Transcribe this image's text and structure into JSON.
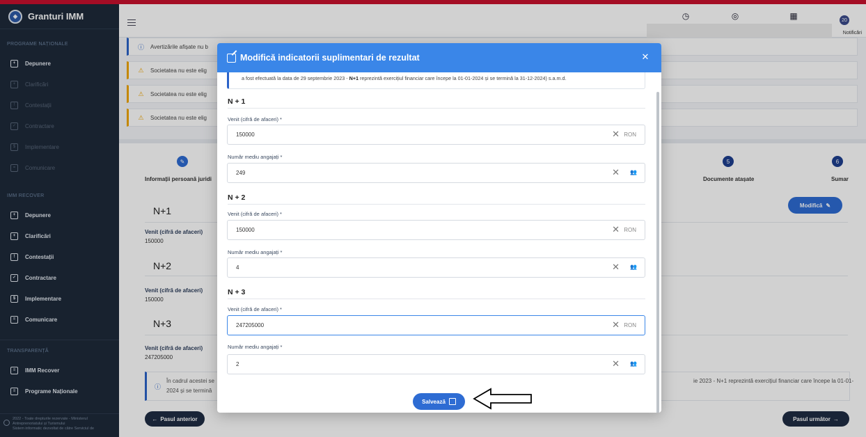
{
  "app": {
    "brand": "Granturi IMM"
  },
  "sidebar": {
    "sections": [
      {
        "title": "PROGRAME NAȚIONALE",
        "items": [
          {
            "label": "Depunere",
            "icon": "plus-box-icon",
            "active": true
          },
          {
            "label": "Clarificări",
            "icon": "plus-box-icon",
            "active": false
          },
          {
            "label": "Contestații",
            "icon": "alert-box-icon",
            "active": false
          },
          {
            "label": "Contractare",
            "icon": "check-box-icon",
            "active": false
          },
          {
            "label": "Implementare",
            "icon": "dollar-box-icon",
            "active": false
          },
          {
            "label": "Comunicare",
            "icon": "chat-box-icon",
            "active": false
          }
        ]
      },
      {
        "title": "IMM RECOVER",
        "items": [
          {
            "label": "Depunere",
            "icon": "plus-box-icon",
            "active": true
          },
          {
            "label": "Clarificări",
            "icon": "plus-box-icon",
            "active": true
          },
          {
            "label": "Contestații",
            "icon": "alert-box-icon",
            "active": true
          },
          {
            "label": "Contractare",
            "icon": "check-box-icon",
            "active": true
          },
          {
            "label": "Implementare",
            "icon": "dollar-box-icon",
            "active": true
          },
          {
            "label": "Comunicare",
            "icon": "chat-box-icon",
            "active": true
          }
        ]
      },
      {
        "title": "TRANSPARENȚĂ",
        "items": [
          {
            "label": "IMM Recover",
            "icon": "list-box-icon",
            "active": true
          },
          {
            "label": "Programe Naționale",
            "icon": "list-box-icon",
            "active": true
          }
        ]
      }
    ],
    "footer": {
      "line1": "2022 - Toate drepturile rezervate - Ministerul",
      "line2": "Antreprenoriatului și Turismului",
      "line3": "Sistem informatic dezvoltat de către Serviciul de"
    }
  },
  "topbar": {
    "notif_label": "Notificări",
    "notif_count": "20"
  },
  "alerts": [
    {
      "type": "info",
      "text": "Avertizările afișate nu b"
    },
    {
      "type": "warn",
      "text": "Societatea nu este elig"
    },
    {
      "type": "warn",
      "text": "Societatea nu este elig"
    },
    {
      "type": "warn",
      "text": "Societatea nu este elig"
    }
  ],
  "steps": {
    "first_label": "Informații persoană juridi",
    "step5_num": "5",
    "step5_label": "Documente atașate",
    "step6_num": "6",
    "step6_label": "Sumar"
  },
  "bg_fields": {
    "n1": "N+1",
    "n2": "N+2",
    "n3": "N+3",
    "venit_label": "Venit (cifră de afaceri)",
    "n1_val": "150000",
    "n2_val": "150000",
    "n3_val": "247205000",
    "modify_label": "Modifică",
    "info_t1": "În cadrul acestei se",
    "info_t2": "2024 și se termină",
    "info_t3": "ie 2023 - N+1 reprezintă exercițiul financiar care începe la 01-01-"
  },
  "nav": {
    "prev": "Pasul anterior",
    "next": "Pasul următor"
  },
  "modal": {
    "title": "Modifică indicatorii suplimentari de rezultat",
    "note_pre": "a fost efectuată la data de 29 septembrie 2023 - ",
    "note_bold": "N+1",
    "note_post": " reprezintă exercițiul financiar care începe la 01-01-2024 și se termină la 31-12-2024) s.a.m.d.",
    "sections": [
      {
        "title": "N + 1",
        "venit_label": "Venit (cifră de afaceri) *",
        "venit": "150000",
        "unit": "RON",
        "angajati_label": "Număr mediu angajați *",
        "angajati": "249"
      },
      {
        "title": "N + 2",
        "venit_label": "Venit (cifră de afaceri) *",
        "venit": "150000",
        "unit": "RON",
        "angajati_label": "Număr mediu angajați *",
        "angajati": "4"
      },
      {
        "title": "N + 3",
        "venit_label": "Venit (cifră de afaceri) *",
        "venit": "247205000",
        "unit": "RON",
        "angajati_label": "Număr mediu angajați *",
        "angajati": "2"
      }
    ],
    "save_label": "Salvează"
  }
}
